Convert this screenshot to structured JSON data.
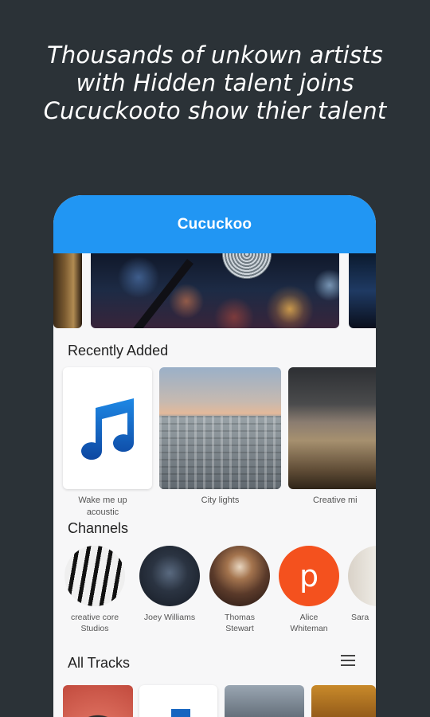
{
  "tagline": {
    "line1": "Thousands of unkown artists",
    "line2": "with Hidden talent joins",
    "line3": "Cucuckooto show thier talent"
  },
  "app": {
    "title": "Cucuckoo"
  },
  "recently_added": {
    "title": "Recently Added",
    "items": [
      {
        "label_line1": "Wake me up",
        "label_line2": "acoustic",
        "icon": "music-note-icon"
      },
      {
        "label_line1": "City lights",
        "label_line2": ""
      },
      {
        "label_line1": "Creative mi",
        "label_line2": ""
      }
    ]
  },
  "channels": {
    "title": "Channels",
    "items": [
      {
        "name_line1": "creative core",
        "name_line2": "Studios"
      },
      {
        "name_line1": "Joey Williams",
        "name_line2": ""
      },
      {
        "name_line1": "Thomas",
        "name_line2": "Stewart"
      },
      {
        "name_line1": "Alice",
        "name_line2": "Whiteman",
        "initial": "p"
      },
      {
        "name_line1": "Sara",
        "name_line2": ""
      }
    ]
  },
  "all_tracks": {
    "title": "All Tracks",
    "menu_icon": "menu-icon"
  },
  "colors": {
    "appbar": "#2196f3",
    "background": "#2b3237",
    "accent_orange": "#f4511e"
  }
}
